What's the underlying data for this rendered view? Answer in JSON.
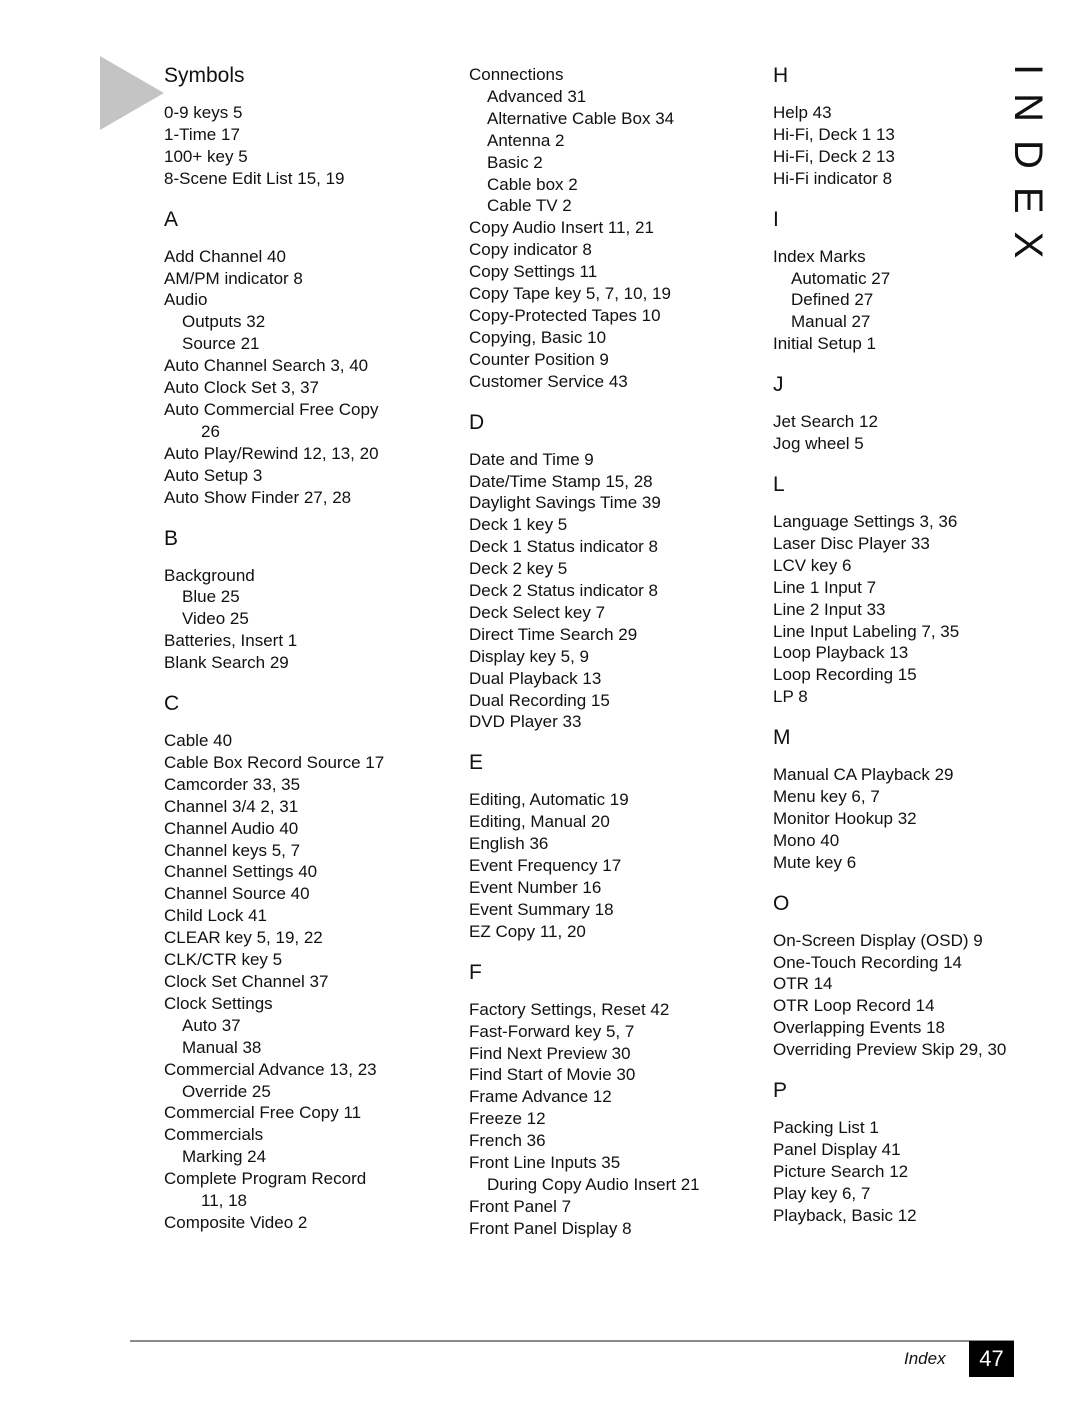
{
  "page": {
    "side_title": "INDEX",
    "footer_label": "Index",
    "page_number": "47"
  },
  "columns": [
    {
      "preface": [],
      "sections": [
        {
          "heading": "Symbols",
          "entries": [
            {
              "text": "0-9 keys  5",
              "level": "main"
            },
            {
              "text": "1-Time  17",
              "level": "main"
            },
            {
              "text": "100+ key  5",
              "level": "main"
            },
            {
              "text": "8-Scene Edit List  15,  19",
              "level": "main"
            }
          ]
        },
        {
          "heading": "A",
          "entries": [
            {
              "text": "Add Channel  40",
              "level": "main"
            },
            {
              "text": "AM/PM indicator  8",
              "level": "main"
            },
            {
              "text": "Audio",
              "level": "main"
            },
            {
              "text": "Outputs  32",
              "level": "sub"
            },
            {
              "text": "Source  21",
              "level": "sub"
            },
            {
              "text": "Auto Channel Search  3,  40",
              "level": "main"
            },
            {
              "text": "Auto Clock Set  3,  37",
              "level": "main"
            },
            {
              "text": "Auto Commercial Free Copy",
              "level": "main"
            },
            {
              "text": "26",
              "level": "cont"
            },
            {
              "text": "Auto Play/Rewind  12,  13,  20",
              "level": "main"
            },
            {
              "text": "Auto Setup  3",
              "level": "main"
            },
            {
              "text": "Auto Show Finder  27,  28",
              "level": "main"
            }
          ]
        },
        {
          "heading": "B",
          "entries": [
            {
              "text": "Background",
              "level": "main"
            },
            {
              "text": "Blue  25",
              "level": "sub"
            },
            {
              "text": "Video  25",
              "level": "sub"
            },
            {
              "text": "Batteries, Insert  1",
              "level": "main"
            },
            {
              "text": "Blank Search  29",
              "level": "main"
            }
          ]
        },
        {
          "heading": "C",
          "entries": [
            {
              "text": "Cable  40",
              "level": "main"
            },
            {
              "text": "Cable Box Record Source  17",
              "level": "main"
            },
            {
              "text": "Camcorder  33,  35",
              "level": "main"
            },
            {
              "text": "Channel 3/4  2,  31",
              "level": "main"
            },
            {
              "text": "Channel Audio  40",
              "level": "main"
            },
            {
              "text": "Channel keys  5,  7",
              "level": "main"
            },
            {
              "text": "Channel Settings  40",
              "level": "main"
            },
            {
              "text": "Channel Source  40",
              "level": "main"
            },
            {
              "text": "Child Lock  41",
              "level": "main"
            },
            {
              "text": "CLEAR key  5,  19,  22",
              "level": "main"
            },
            {
              "text": "CLK/CTR key  5",
              "level": "main"
            },
            {
              "text": "Clock Set Channel  37",
              "level": "main"
            },
            {
              "text": "Clock Settings",
              "level": "main"
            },
            {
              "text": "Auto  37",
              "level": "sub"
            },
            {
              "text": "Manual  38",
              "level": "sub"
            },
            {
              "text": "Commercial Advance  13,  23",
              "level": "main"
            },
            {
              "text": "Override  25",
              "level": "sub"
            },
            {
              "text": "Commercial Free Copy  11",
              "level": "main"
            },
            {
              "text": "Commercials",
              "level": "main"
            },
            {
              "text": "Marking  24",
              "level": "sub"
            },
            {
              "text": "Complete Program Record",
              "level": "main"
            },
            {
              "text": "11,  18",
              "level": "cont"
            },
            {
              "text": "Composite Video  2",
              "level": "main"
            }
          ]
        }
      ]
    },
    {
      "preface": [
        {
          "text": "Connections",
          "level": "main"
        },
        {
          "text": "Advanced  31",
          "level": "sub"
        },
        {
          "text": "Alternative Cable Box  34",
          "level": "sub"
        },
        {
          "text": "Antenna  2",
          "level": "sub"
        },
        {
          "text": "Basic  2",
          "level": "sub"
        },
        {
          "text": "Cable box  2",
          "level": "sub"
        },
        {
          "text": "Cable TV  2",
          "level": "sub"
        },
        {
          "text": "Copy Audio Insert  11,  21",
          "level": "main"
        },
        {
          "text": "Copy indicator  8",
          "level": "main"
        },
        {
          "text": "Copy Settings  11",
          "level": "main"
        },
        {
          "text": "Copy Tape key  5,  7,  10,  19",
          "level": "main"
        },
        {
          "text": "Copy-Protected Tapes  10",
          "level": "main"
        },
        {
          "text": "Copying, Basic  10",
          "level": "main"
        },
        {
          "text": "Counter Position  9",
          "level": "main"
        },
        {
          "text": "Customer Service  43",
          "level": "main"
        }
      ],
      "sections": [
        {
          "heading": "D",
          "entries": [
            {
              "text": "Date and Time  9",
              "level": "main"
            },
            {
              "text": "Date/Time Stamp  15,  28",
              "level": "main"
            },
            {
              "text": "Daylight Savings Time  39",
              "level": "main"
            },
            {
              "text": "Deck 1 key  5",
              "level": "main"
            },
            {
              "text": "Deck 1 Status indicator  8",
              "level": "main"
            },
            {
              "text": "Deck 2 key  5",
              "level": "main"
            },
            {
              "text": "Deck 2 Status indicator  8",
              "level": "main"
            },
            {
              "text": "Deck Select key  7",
              "level": "main"
            },
            {
              "text": "Direct Time Search  29",
              "level": "main"
            },
            {
              "text": "Display key  5,  9",
              "level": "main"
            },
            {
              "text": "Dual Playback  13",
              "level": "main"
            },
            {
              "text": "Dual Recording  15",
              "level": "main"
            },
            {
              "text": "DVD Player  33",
              "level": "main"
            }
          ]
        },
        {
          "heading": "E",
          "entries": [
            {
              "text": "Editing, Automatic  19",
              "level": "main"
            },
            {
              "text": "Editing, Manual  20",
              "level": "main"
            },
            {
              "text": "English  36",
              "level": "main"
            },
            {
              "text": "Event Frequency  17",
              "level": "main"
            },
            {
              "text": "Event Number  16",
              "level": "main"
            },
            {
              "text": "Event Summary  18",
              "level": "main"
            },
            {
              "text": "EZ Copy  11,  20",
              "level": "main"
            }
          ]
        },
        {
          "heading": "F",
          "entries": [
            {
              "text": "Factory Settings, Reset  42",
              "level": "main"
            },
            {
              "text": "Fast-Forward key  5,  7",
              "level": "main"
            },
            {
              "text": "Find Next Preview  30",
              "level": "main"
            },
            {
              "text": "Find Start of Movie  30",
              "level": "main"
            },
            {
              "text": "Frame Advance  12",
              "level": "main"
            },
            {
              "text": "Freeze  12",
              "level": "main"
            },
            {
              "text": "French  36",
              "level": "main"
            },
            {
              "text": "Front Line Inputs  35",
              "level": "main"
            },
            {
              "text": "During Copy Audio Insert  21",
              "level": "sub"
            },
            {
              "text": "Front Panel  7",
              "level": "main"
            },
            {
              "text": "Front Panel Display  8",
              "level": "main"
            }
          ]
        }
      ]
    },
    {
      "preface": [],
      "sections": [
        {
          "heading": "H",
          "entries": [
            {
              "text": "Help  43",
              "level": "main"
            },
            {
              "text": "Hi-Fi, Deck 1  13",
              "level": "main"
            },
            {
              "text": "Hi-Fi, Deck 2  13",
              "level": "main"
            },
            {
              "text": "Hi-Fi indicator  8",
              "level": "main"
            }
          ]
        },
        {
          "heading": "I",
          "entries": [
            {
              "text": "Index Marks",
              "level": "main"
            },
            {
              "text": "Automatic  27",
              "level": "sub"
            },
            {
              "text": "Defined  27",
              "level": "sub"
            },
            {
              "text": "Manual  27",
              "level": "sub"
            },
            {
              "text": "Initial Setup  1",
              "level": "main"
            }
          ]
        },
        {
          "heading": "J",
          "entries": [
            {
              "text": "Jet Search  12",
              "level": "main"
            },
            {
              "text": "Jog wheel  5",
              "level": "main"
            }
          ]
        },
        {
          "heading": "L",
          "entries": [
            {
              "text": "Language Settings  3,  36",
              "level": "main"
            },
            {
              "text": "Laser Disc Player  33",
              "level": "main"
            },
            {
              "text": "LCV key  6",
              "level": "main"
            },
            {
              "text": "Line 1 Input  7",
              "level": "main"
            },
            {
              "text": "Line 2 Input  33",
              "level": "main"
            },
            {
              "text": "Line Input Labeling  7,  35",
              "level": "main"
            },
            {
              "text": "Loop Playback  13",
              "level": "main"
            },
            {
              "text": "Loop Recording  15",
              "level": "main"
            },
            {
              "text": "LP  8",
              "level": "main"
            }
          ]
        },
        {
          "heading": "M",
          "entries": [
            {
              "text": "Manual CA Playback  29",
              "level": "main"
            },
            {
              "text": "Menu key  6,  7",
              "level": "main"
            },
            {
              "text": "Monitor Hookup  32",
              "level": "main"
            },
            {
              "text": "Mono  40",
              "level": "main"
            },
            {
              "text": "Mute key  6",
              "level": "main"
            }
          ]
        },
        {
          "heading": "O",
          "entries": [
            {
              "text": "On-Screen Display (OSD)  9",
              "level": "main"
            },
            {
              "text": "One-Touch Recording  14",
              "level": "main"
            },
            {
              "text": "OTR  14",
              "level": "main"
            },
            {
              "text": "OTR Loop Record  14",
              "level": "main"
            },
            {
              "text": "Overlapping Events  18",
              "level": "main"
            },
            {
              "text": "Overriding Preview Skip  29,  30",
              "level": "main"
            }
          ]
        },
        {
          "heading": "P",
          "entries": [
            {
              "text": "Packing List  1",
              "level": "main"
            },
            {
              "text": "Panel Display  41",
              "level": "main"
            },
            {
              "text": "Picture Search  12",
              "level": "main"
            },
            {
              "text": "Play key  6,  7",
              "level": "main"
            },
            {
              "text": "Playback, Basic  12",
              "level": "main"
            }
          ]
        }
      ]
    }
  ]
}
